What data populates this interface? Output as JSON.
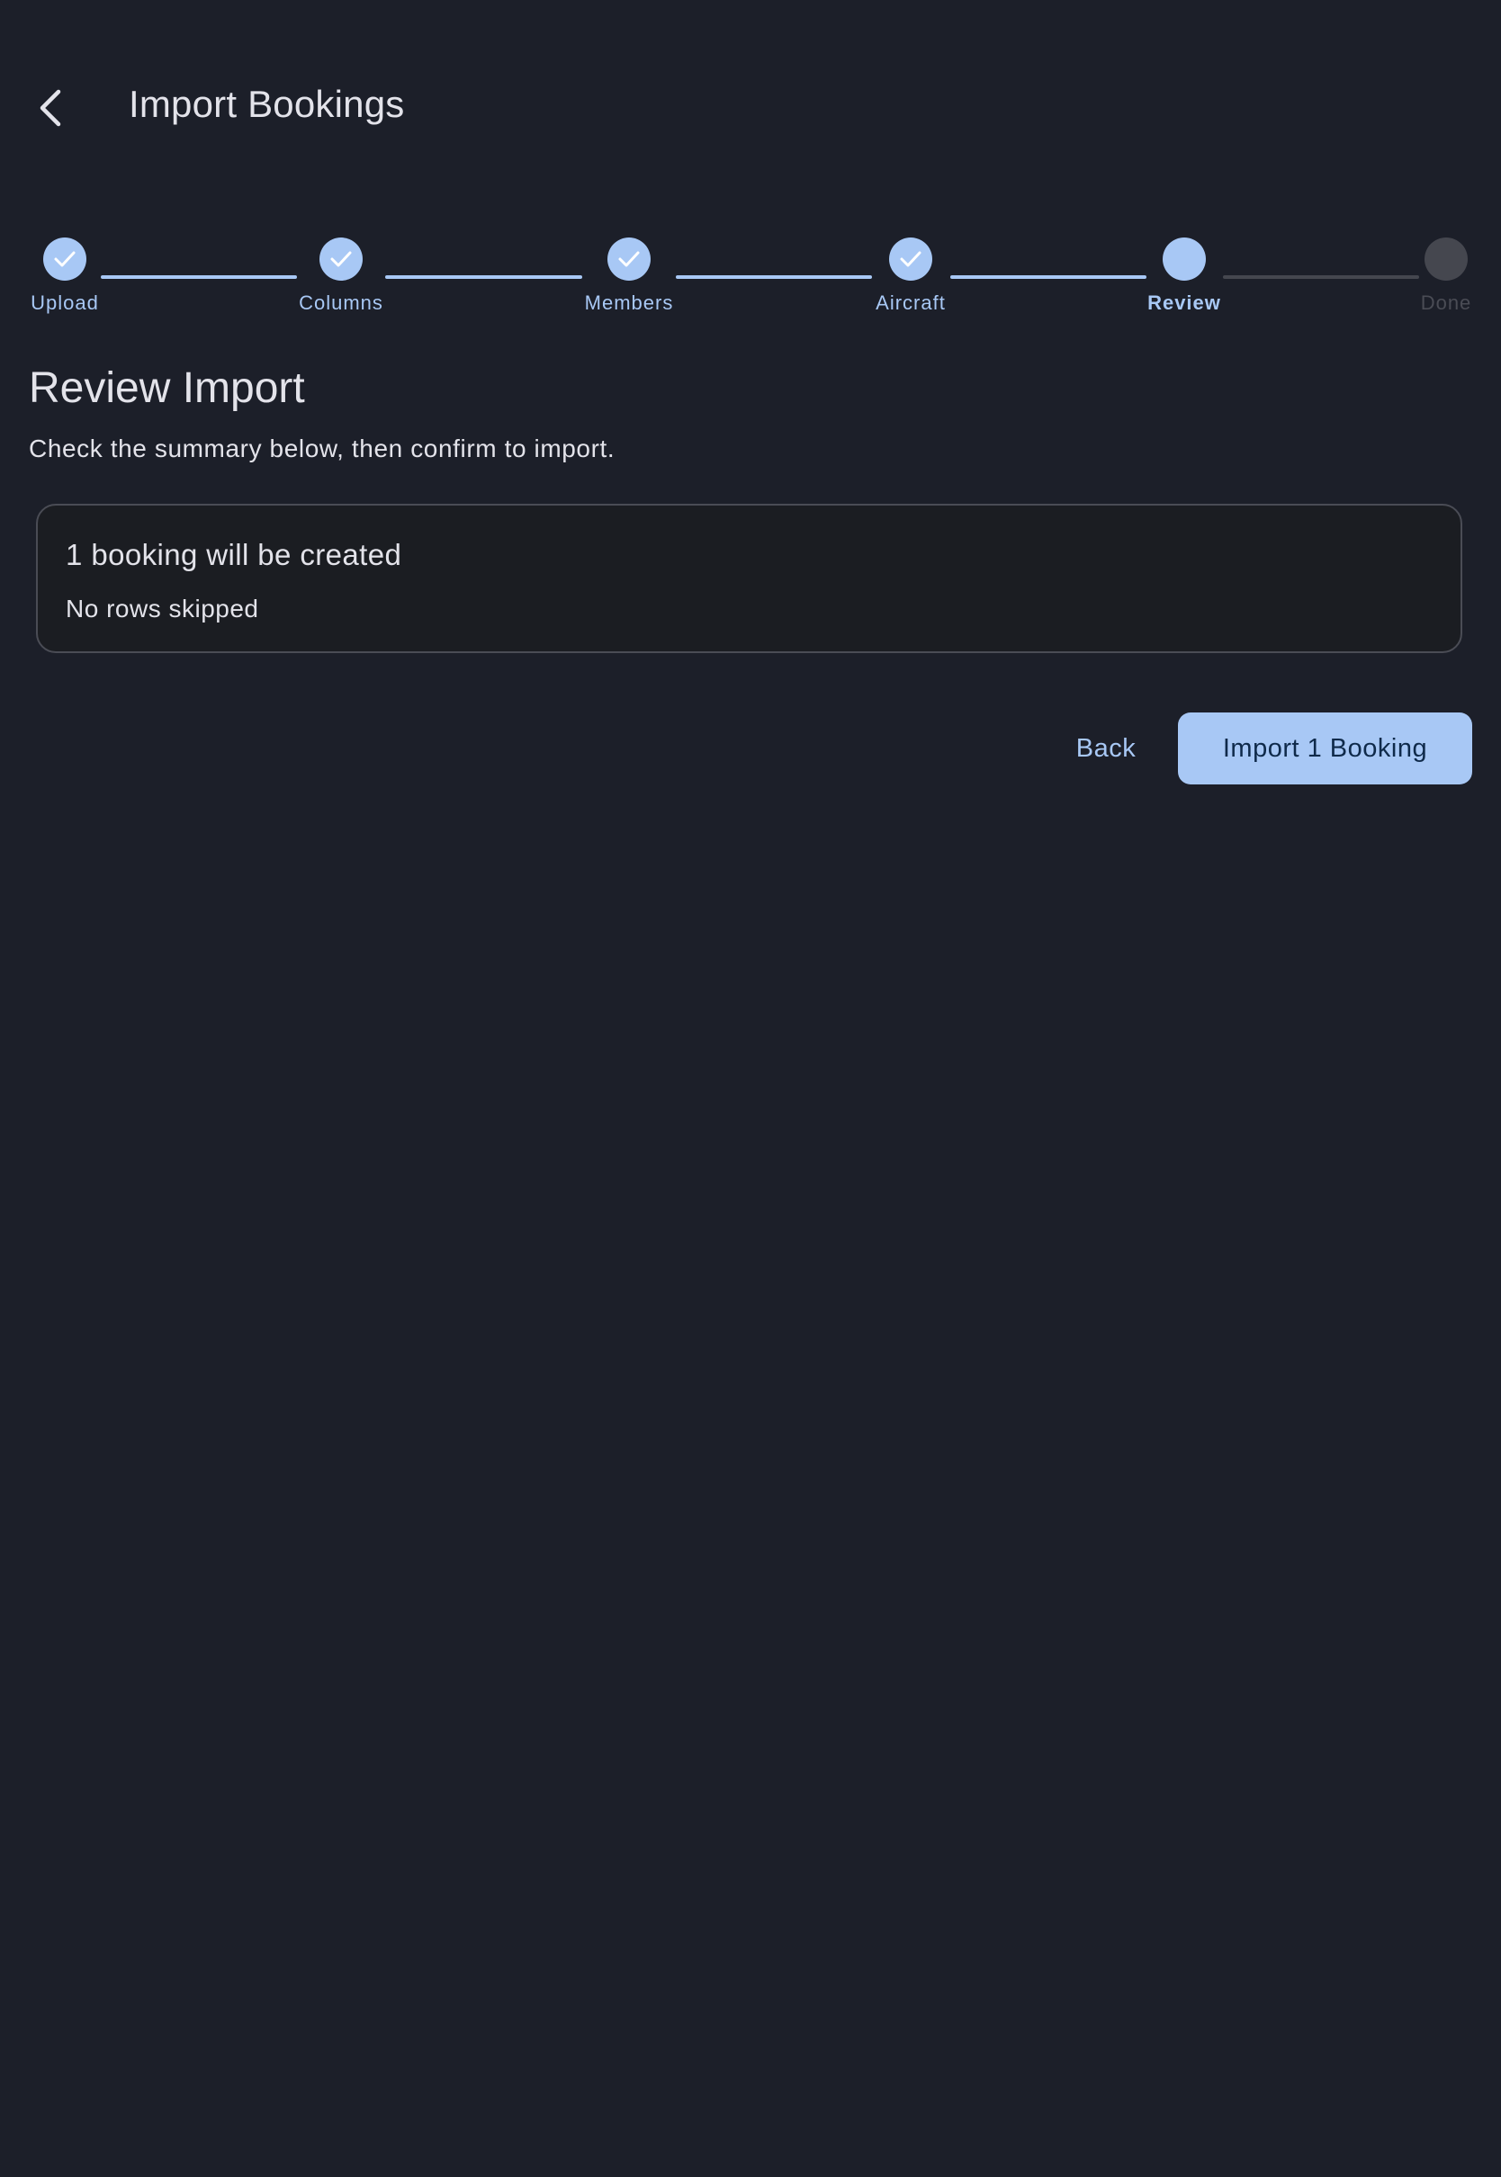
{
  "header": {
    "title": "Import Bookings",
    "back_icon": "chevron-left-icon"
  },
  "stepper": {
    "steps": [
      {
        "label": "Upload",
        "state": "complete"
      },
      {
        "label": "Columns",
        "state": "complete"
      },
      {
        "label": "Members",
        "state": "complete"
      },
      {
        "label": "Aircraft",
        "state": "complete"
      },
      {
        "label": "Review",
        "state": "active"
      },
      {
        "label": "Done",
        "state": "pending"
      }
    ]
  },
  "review": {
    "title": "Review Import",
    "subtitle": "Check the summary below, then confirm to import.",
    "summary": {
      "primary": "1 booking will be created",
      "secondary": "No rows skipped"
    }
  },
  "actions": {
    "back_label": "Back",
    "import_label": "Import 1 Booking"
  },
  "colors": {
    "background": "#1c1f29",
    "accent": "#a8c8f5",
    "pending": "#45474f",
    "card_border": "#4a4c55"
  }
}
